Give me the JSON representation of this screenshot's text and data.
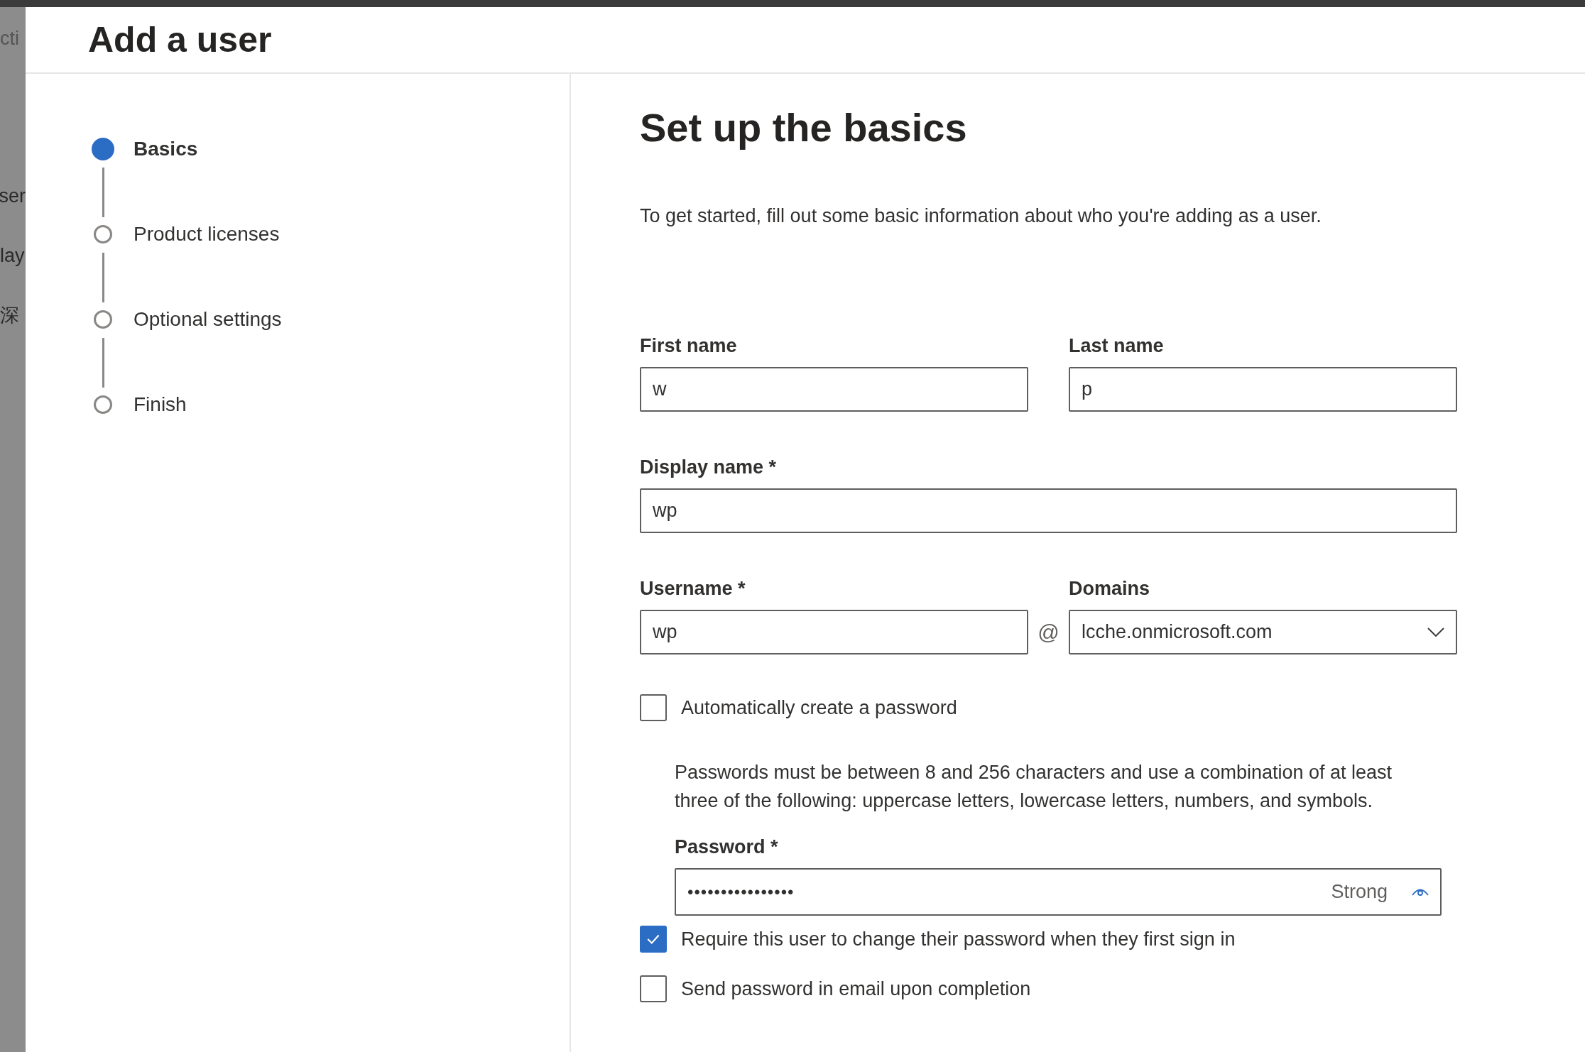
{
  "background_page": {
    "fragments": [
      {
        "text": "cti",
        "kind": "small"
      },
      {
        "text": "ser",
        "kind": "item"
      },
      {
        "text": "lay",
        "kind": "item"
      },
      {
        "text": "深",
        "kind": "item"
      }
    ]
  },
  "panel": {
    "title": "Add a user",
    "steps": [
      {
        "label": "Basics",
        "selected": true
      },
      {
        "label": "Product licenses",
        "selected": false
      },
      {
        "label": "Optional settings",
        "selected": false
      },
      {
        "label": "Finish",
        "selected": false
      }
    ],
    "heading": "Set up the basics",
    "description": "To get started, fill out some basic information about who you're adding as a user.",
    "first_name": {
      "label": "First name",
      "value": "w"
    },
    "last_name": {
      "label": "Last name",
      "value": "p"
    },
    "display_name": {
      "label": "Display name *",
      "value": "wp"
    },
    "username": {
      "label": "Username *",
      "value": "wp"
    },
    "at_sign": "@",
    "domains": {
      "label": "Domains",
      "value": "lcche.onmicrosoft.com"
    },
    "auto_password": {
      "label": "Automatically create a password",
      "checked": false
    },
    "password_rules": "Passwords must be between 8 and 256 characters and use a combination of at least three of the following: uppercase letters, lowercase letters, numbers, and symbols.",
    "password": {
      "label": "Password *",
      "value": "••••••••••••••••",
      "strength": "Strong"
    },
    "require_change": {
      "label": "Require this user to change their password when they first sign in",
      "checked": true
    },
    "send_email": {
      "label": "Send password in email upon completion",
      "checked": false
    }
  }
}
